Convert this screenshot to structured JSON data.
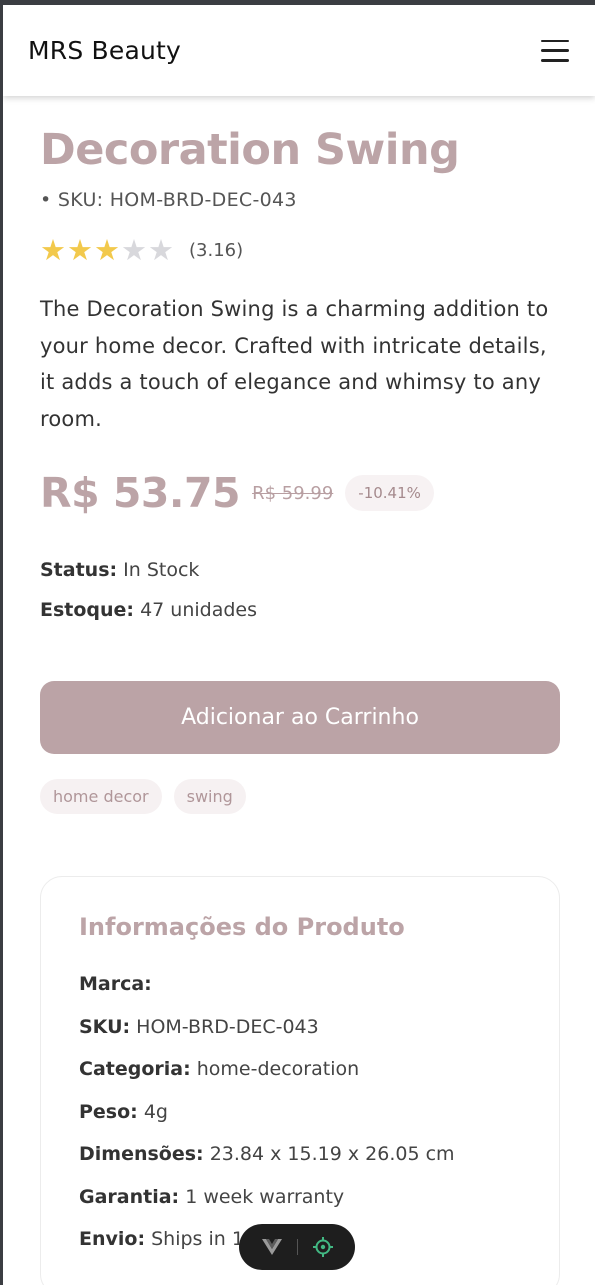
{
  "header": {
    "brand": "MRS Beauty",
    "menu_icon": "hamburger-menu-icon"
  },
  "product": {
    "title": "Decoration Swing",
    "sku_line": "• SKU: HOM-BRD-DEC-043",
    "rating": {
      "stars_filled": 3,
      "stars_total": 5,
      "value_label": "(3.16)"
    },
    "description": "The Decoration Swing is a charming addition to your home decor. Crafted with intricate details, it adds a touch of elegance and whimsy to any room.",
    "price": "R$ 53.75",
    "old_price": "R$ 59.99",
    "discount": "-10.41%",
    "status": {
      "label": "Status:",
      "value": "In Stock"
    },
    "stock": {
      "label": "Estoque:",
      "value": "47 unidades"
    },
    "add_to_cart": "Adicionar ao Carrinho",
    "tags": [
      "home decor",
      "swing"
    ]
  },
  "info": {
    "title": "Informações do Produto",
    "rows": [
      {
        "label": "Marca:",
        "value": ""
      },
      {
        "label": "SKU:",
        "value": "HOM-BRD-DEC-043"
      },
      {
        "label": "Categoria:",
        "value": "home-decoration"
      },
      {
        "label": "Peso:",
        "value": "4g"
      },
      {
        "label": "Dimensões:",
        "value": "23.84 x 15.19 x 26.05 cm"
      },
      {
        "label": "Garantia:",
        "value": "1 week warranty"
      },
      {
        "label": "Envio:",
        "value": "Ships in 1 month"
      }
    ]
  },
  "colors": {
    "accent": "#bca4a7",
    "star": "#f2c94c",
    "star_empty": "#d8d8dc"
  },
  "devtools": {
    "icons": [
      "vue-logo-icon",
      "target-icon"
    ]
  }
}
